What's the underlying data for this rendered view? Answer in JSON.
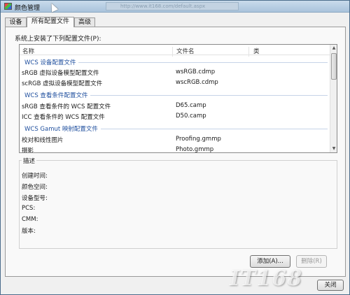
{
  "window": {
    "title": "颜色管理",
    "address_text": "http://www.it168.com/default.aspx"
  },
  "tabs": [
    {
      "label": "设备",
      "active": false
    },
    {
      "label": "所有配置文件",
      "active": true
    },
    {
      "label": "高级",
      "active": false
    }
  ],
  "profiles_label": "系统上安装了下列配置文件(P):",
  "list": {
    "columns": [
      "名称",
      "文件名",
      "类"
    ],
    "groups": [
      {
        "title": "WCS 设备配置文件",
        "rows": [
          {
            "name": "sRGB 虚拟设备模型配置文件",
            "file": "wsRGB.cdmp"
          },
          {
            "name": "scRGB 虚拟设备模型配置文件",
            "file": "wscRGB.cdmp"
          }
        ]
      },
      {
        "title": "WCS 查看条件配置文件",
        "rows": [
          {
            "name": "sRGB 查看条件的 WCS 配置文件",
            "file": "D65.camp"
          },
          {
            "name": "ICC 查看条件的 WCS 配置文件",
            "file": "D50.camp"
          }
        ]
      },
      {
        "title": "WCS Gamut 映射配置文件",
        "rows": [
          {
            "name": "校对和线性图片",
            "file": "Proofing.gmmp"
          },
          {
            "name": "摄影",
            "file": "Photo.gmmp"
          }
        ]
      }
    ]
  },
  "description": {
    "legend": "描述",
    "fields": [
      "创建时间:",
      "颜色空间:",
      "设备型号:",
      "PCS:",
      "CMM:",
      "版本:"
    ]
  },
  "buttons": {
    "add": "添加(A)...",
    "remove": "删除(R)",
    "close": "关闭"
  },
  "watermark": "IT168",
  "colors": {
    "group_title": "#1f4f9e",
    "title_bar": "#b9cfe4",
    "watermark": "#ffffff"
  }
}
